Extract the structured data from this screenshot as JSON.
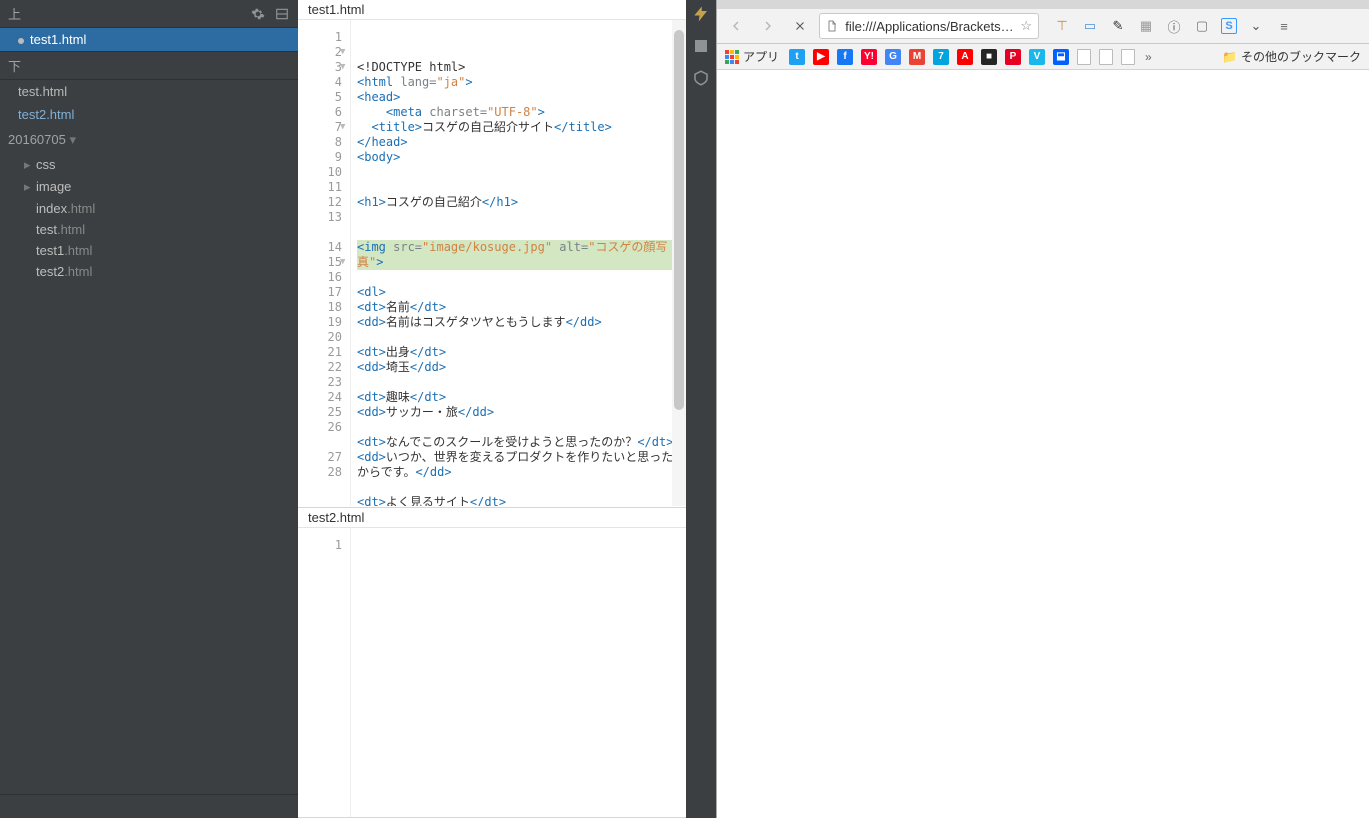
{
  "sidebar": {
    "top_section_label": "上",
    "bottom_section_label": "下",
    "open_files_top": [
      {
        "name": "test1",
        "ext": ".html",
        "modified": true,
        "active": true
      }
    ],
    "open_files_bottom": [
      {
        "name": "test",
        "ext": ".html",
        "modified": false,
        "active": false
      },
      {
        "name": "test2",
        "ext": ".html",
        "modified": false,
        "active": false,
        "mod_color": true
      }
    ],
    "project_name": "20160705",
    "tree": [
      {
        "label": "css",
        "type": "folder"
      },
      {
        "label": "image",
        "type": "folder"
      },
      {
        "label": "index",
        "ext": ".html",
        "type": "file"
      },
      {
        "label": "test",
        "ext": ".html",
        "type": "file"
      },
      {
        "label": "test1",
        "ext": ".html",
        "type": "file"
      },
      {
        "label": "test2",
        "ext": ".html",
        "type": "file"
      }
    ]
  },
  "editor_top": {
    "filename": "test1.html",
    "lines": [
      {
        "n": 1,
        "segs": [
          [
            "txt",
            "<!DOCTYPE html>"
          ]
        ]
      },
      {
        "n": 2,
        "fold": true,
        "segs": [
          [
            "tag",
            "<html"
          ],
          [
            "attr",
            " lang="
          ],
          [
            "str",
            "\"ja\""
          ],
          [
            "tag",
            ">"
          ]
        ]
      },
      {
        "n": 3,
        "fold": true,
        "segs": [
          [
            "tag",
            "<head>"
          ]
        ]
      },
      {
        "n": 4,
        "indent": 2,
        "segs": [
          [
            "tag",
            "<meta"
          ],
          [
            "attr",
            " charset="
          ],
          [
            "str",
            "\"UTF-8\""
          ],
          [
            "tag",
            ">"
          ]
        ]
      },
      {
        "n": 5,
        "indent": 1,
        "segs": [
          [
            "tag",
            "<title>"
          ],
          [
            "txt",
            "コスゲの自己紹介サイト"
          ],
          [
            "tag",
            "</title>"
          ]
        ]
      },
      {
        "n": 6,
        "segs": [
          [
            "tag",
            "</head>"
          ]
        ]
      },
      {
        "n": 7,
        "fold": true,
        "segs": [
          [
            "tag",
            "<body>"
          ]
        ]
      },
      {
        "n": 8,
        "segs": []
      },
      {
        "n": 9,
        "segs": []
      },
      {
        "n": 10,
        "segs": [
          [
            "tag",
            "<h1>"
          ],
          [
            "txt",
            "コスゲの自己紹介"
          ],
          [
            "tag",
            "</h1>"
          ]
        ]
      },
      {
        "n": 11,
        "segs": []
      },
      {
        "n": 12,
        "segs": []
      },
      {
        "n": 13,
        "hl": true,
        "segs": [
          [
            "tag",
            "<img"
          ],
          [
            "attr",
            " src="
          ],
          [
            "str",
            "\"image/kosuge.jpg\""
          ],
          [
            "attr",
            " alt="
          ],
          [
            "str",
            "\"コスゲの顔写真\""
          ],
          [
            "tag",
            ">"
          ]
        ]
      },
      {
        "n": 14,
        "segs": []
      },
      {
        "n": 15,
        "fold": true,
        "segs": [
          [
            "tag",
            "<dl>"
          ]
        ]
      },
      {
        "n": 16,
        "segs": [
          [
            "tag",
            "<dt>"
          ],
          [
            "txt",
            "名前"
          ],
          [
            "tag",
            "</dt>"
          ]
        ]
      },
      {
        "n": 17,
        "segs": [
          [
            "tag",
            "<dd>"
          ],
          [
            "txt",
            "名前はコスゲタツヤともうします"
          ],
          [
            "tag",
            "</dd>"
          ]
        ]
      },
      {
        "n": 18,
        "segs": []
      },
      {
        "n": 19,
        "segs": [
          [
            "tag",
            "<dt>"
          ],
          [
            "txt",
            "出身"
          ],
          [
            "tag",
            "</dt>"
          ]
        ]
      },
      {
        "n": 20,
        "segs": [
          [
            "tag",
            "<dd>"
          ],
          [
            "txt",
            "埼玉"
          ],
          [
            "tag",
            "</dd>"
          ]
        ]
      },
      {
        "n": 21,
        "segs": []
      },
      {
        "n": 22,
        "segs": [
          [
            "tag",
            "<dt>"
          ],
          [
            "txt",
            "趣味"
          ],
          [
            "tag",
            "</dt>"
          ]
        ]
      },
      {
        "n": 23,
        "segs": [
          [
            "tag",
            "<dd>"
          ],
          [
            "txt",
            "サッカー・旅"
          ],
          [
            "tag",
            "</dd>"
          ]
        ]
      },
      {
        "n": 24,
        "segs": []
      },
      {
        "n": 25,
        "segs": [
          [
            "tag",
            "<dt>"
          ],
          [
            "txt",
            "なんでこのスクールを受けようと思ったのか？"
          ],
          [
            "tag",
            "</dt>"
          ]
        ]
      },
      {
        "n": 26,
        "segs": [
          [
            "tag",
            "<dd>"
          ],
          [
            "txt",
            "いつか、世界を変えるプロダクトを作りたいと思ったからです。"
          ],
          [
            "tag",
            "</dd>"
          ]
        ]
      },
      {
        "n": 27,
        "segs": []
      },
      {
        "n": 28,
        "segs": [
          [
            "tag",
            "<dt>"
          ],
          [
            "txt",
            "よく見るサイト"
          ],
          [
            "tag",
            "</dt>"
          ]
        ]
      }
    ]
  },
  "editor_bottom": {
    "filename": "test2.html",
    "lines": [
      {
        "n": 1,
        "segs": []
      }
    ]
  },
  "chrome": {
    "url": "file:///Applications/Brackets.a…",
    "apps_label": "アプリ",
    "other_bookmarks": "その他のブックマーク",
    "more_chevron": "»",
    "toolbar_colors": {
      "twitter": "#1DA1F2",
      "youtube": "#FF0000",
      "facebook": "#1877F2",
      "yahoo": "#FF0033",
      "google": "#4285F4",
      "gmail": "#EA4335",
      "hatena": "#00A4DE",
      "adobe": "#FF0000",
      "nico": "#252525",
      "pinterest": "#E60023",
      "vimeo": "#1AB7EA",
      "dropbox": "#0061FF",
      "evernote": "#2DBE60",
      "screen": "#3B99FC",
      "pocket": "#EF3F56"
    }
  }
}
